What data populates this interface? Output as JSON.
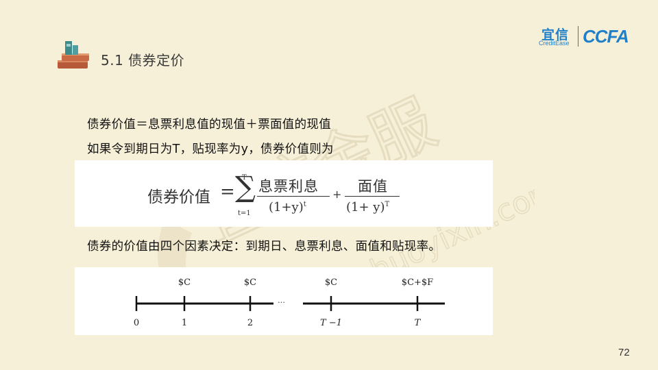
{
  "header": {
    "title": "5.1 债券定价",
    "icon": "books-icon"
  },
  "logos": {
    "yixin_cn": "宜信",
    "yixin_en": "CreditEase",
    "ccfa": "CCFA"
  },
  "watermark": {
    "text_cn": "宜信金服",
    "text_url": "xinhuoyixin.com"
  },
  "body": {
    "line1": "债券价值＝息票利息值的现值＋票面值的现值",
    "line2": "如果令到期日为T，贴现率为y，债券价值则为",
    "line3": "债券的价值由四个因素决定：到期日、息票利息、面值和贴现率。"
  },
  "formula": {
    "label": "债券价值",
    "equals": "=",
    "sigma": "∑",
    "sigma_top": "T",
    "sigma_bottom": "t=1",
    "numerator1": "息票利息",
    "denominator1_base": "(1+y)",
    "denominator1_exp": "t",
    "plus": "+",
    "numerator2": "面值",
    "denominator2_base": "(1+ y)",
    "denominator2_exp": "T"
  },
  "timeline": {
    "ticks": [
      {
        "bottom": "0",
        "top": ""
      },
      {
        "bottom": "1",
        "top": "$C"
      },
      {
        "bottom": "2",
        "top": "$C"
      },
      {
        "bottom": "T −1",
        "top": "$C"
      },
      {
        "bottom": "T",
        "top": "$C+$F"
      }
    ],
    "ellipsis": "…"
  },
  "page_number": "72"
}
